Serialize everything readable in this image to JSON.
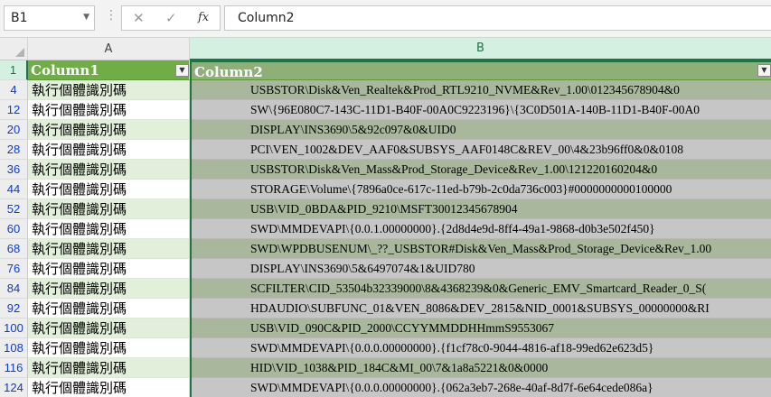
{
  "formula_bar": {
    "name_box": "B1",
    "formula": "Column2",
    "icons": [
      "cancel-icon",
      "enter-icon",
      "function-icon"
    ]
  },
  "columns": [
    "A",
    "B"
  ],
  "header_row": {
    "row": "1",
    "col_a": "Column1",
    "col_b": "Column2"
  },
  "rows": [
    {
      "row": "4",
      "a": "執行個體識別碼",
      "b": "USBSTOR\\Disk&Ven_Realtek&Prod_RTL9210_NVME&Rev_1.00\\012345678904&0"
    },
    {
      "row": "12",
      "a": "執行個體識別碼",
      "b": "SW\\{96E080C7-143C-11D1-B40F-00A0C9223196}\\{3C0D501A-140B-11D1-B40F-00A0"
    },
    {
      "row": "20",
      "a": "執行個體識別碼",
      "b": "DISPLAY\\INS3690\\5&92c097&0&UID0"
    },
    {
      "row": "28",
      "a": "執行個體識別碼",
      "b": "PCI\\VEN_1002&DEV_AAF0&SUBSYS_AAF0148C&REV_00\\4&23b96ff0&0&0108"
    },
    {
      "row": "36",
      "a": "執行個體識別碼",
      "b": "USBSTOR\\Disk&Ven_Mass&Prod_Storage_Device&Rev_1.00\\121220160204&0"
    },
    {
      "row": "44",
      "a": "執行個體識別碼",
      "b": "STORAGE\\Volume\\{7896a0ce-617c-11ed-b79b-2c0da736c003}#0000000000100000"
    },
    {
      "row": "52",
      "a": "執行個體識別碼",
      "b": "USB\\VID_0BDA&PID_9210\\MSFT30012345678904"
    },
    {
      "row": "60",
      "a": "執行個體識別碼",
      "b": "SWD\\MMDEVAPI\\{0.0.1.00000000}.{2d8d4e9d-8ff4-49a1-9868-d0b3e502f450}"
    },
    {
      "row": "68",
      "a": "執行個體識別碼",
      "b": "SWD\\WPDBUSENUM\\_??_USBSTOR#Disk&Ven_Mass&Prod_Storage_Device&Rev_1.00"
    },
    {
      "row": "76",
      "a": "執行個體識別碼",
      "b": "DISPLAY\\INS3690\\5&6497074&1&UID780"
    },
    {
      "row": "84",
      "a": "執行個體識別碼",
      "b": "SCFILTER\\CID_53504b32339000\\8&4368239&0&Generic_EMV_Smartcard_Reader_0_S("
    },
    {
      "row": "92",
      "a": "執行個體識別碼",
      "b": "HDAUDIO\\SUBFUNC_01&VEN_8086&DEV_2815&NID_0001&SUBSYS_00000000&RI"
    },
    {
      "row": "100",
      "a": "執行個體識別碼",
      "b": "USB\\VID_090C&PID_2000\\CCYYMMDDHHmmS9553067"
    },
    {
      "row": "108",
      "a": "執行個體識別碼",
      "b": "SWD\\MMDEVAPI\\{0.0.0.00000000}.{f1cf78c0-9044-4816-af18-99ed62e623d5}"
    },
    {
      "row": "116",
      "a": "執行個體識別碼",
      "b": "HID\\VID_1038&PID_184C&MI_00\\7&1a8a5221&0&0000"
    },
    {
      "row": "124",
      "a": "執行個體識別碼",
      "b": "SWD\\MMDEVAPI\\{0.0.0.00000000}.{062a3eb7-268e-40af-8d7f-6e64cede086a}"
    }
  ],
  "colors": {
    "header_fill": "#70ad47",
    "band_a": "#e2efda",
    "band_b_light": "#c6c6c6",
    "band_b_dark": "#a9b89d",
    "selection": "#217346",
    "row_number_blue": "#0b3bd6"
  }
}
